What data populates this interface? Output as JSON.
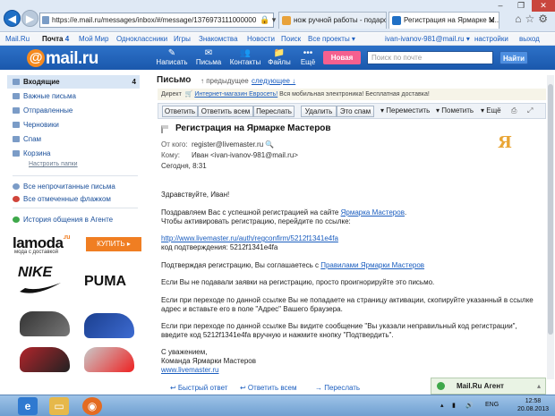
{
  "browser": {
    "url": "https://e.mail.ru/messages/inbox/#/message/1376973111000000",
    "tabs": [
      {
        "title": "нож ручной работы - подаро...",
        "active": false
      },
      {
        "title": "Регистрация на Ярмарке М...",
        "active": true
      }
    ]
  },
  "topnav": {
    "items": [
      "Mail.Ru",
      "Почта",
      "Мой Мир",
      "Одноклассники",
      "Игры",
      "Знакомства",
      "Новости",
      "Поиск",
      "Все проекты ▾"
    ],
    "mail_count": "4",
    "user": "ivan-ivanov-981@mail.ru ▾",
    "settings": "настройки",
    "logout": "выход"
  },
  "header": {
    "logo_text": "mail.ru",
    "buttons": [
      {
        "label": "Написать",
        "icon": "✎"
      },
      {
        "label": "Письма",
        "icon": "✉"
      },
      {
        "label": "Контакты",
        "icon": "👥"
      },
      {
        "label": "Файлы",
        "icon": "📁"
      },
      {
        "label": "Ещё",
        "icon": "•••"
      }
    ],
    "new_label": "Новая",
    "search_placeholder": "Поиск по почте",
    "find_label": "Найти"
  },
  "sidebar": {
    "folders": [
      {
        "label": "Входящие",
        "count": "4"
      },
      {
        "label": "Важные письма",
        "count": ""
      },
      {
        "label": "Отправленные",
        "count": ""
      },
      {
        "label": "Черновики",
        "count": ""
      },
      {
        "label": "Спам",
        "count": ""
      },
      {
        "label": "Корзина",
        "count": ""
      }
    ],
    "setup_folders": "Настроить папки",
    "unread_link": "Все непрочитанные письма",
    "flagged_link": "Все отмеченные флажком",
    "agent_history": "История общения в Агенте"
  },
  "ad": {
    "brand": "lamoda",
    "brand_suffix": ".ru",
    "subtitle": "мода с доставкой",
    "buy_label": "КУПИТЬ ▸",
    "logos": [
      "NIKE",
      "PUMA"
    ]
  },
  "message": {
    "heading": "Письмо",
    "prev": "↑ предыдущее",
    "next": "следующее ↓",
    "direct_label": "Директ",
    "direct_link": "Интернет-магазин Евросеть!",
    "direct_text": "Вся мобильная электроника! Бесплатная доставка!",
    "actions": [
      "Ответить",
      "Ответить всем",
      "Переслать",
      "Удалить",
      "Это спам"
    ],
    "dropdowns": [
      "▾ Переместить",
      "▾ Пометить",
      "▾ Ещё"
    ],
    "subject": "Регистрация на Ярмарке Мастеров",
    "from_label": "От кого:",
    "from_value": "register@livemaster.ru",
    "to_label": "Кому:",
    "to_value": "Иван <ivan-ivanov-981@mail.ru>",
    "date": "Сегодня, 8:31",
    "logo_mark": "Я",
    "greeting": "Здравствуйте, Иван!",
    "p1_line1_pre": "Поздравляем Вас с успешной регистрацией на сайте ",
    "p1_link": "Ярмарка Мастеров",
    "p1_line2": "Чтобы активировать регистрацию, перейдите по ссылке:",
    "confirm_link": "http://www.livemaster.ru/auth/regconfirm/5212f1341e4fa",
    "code_line": "код подтверждения: 5212f1341e4fa",
    "p2_pre": "Подтверждая регистрацию, Вы соглашаетесь с ",
    "p2_link": "Правилами Ярмарки Мастеров",
    "p3": "Если Вы не подавали заявки на регистрацию, просто проигнорируйте это письмо.",
    "p4_line1": "Если при переходе по данной ссылке Вы не попадаете на страницу активации, скопируйте указанный в ссылке",
    "p4_line2": "адрес и вставьте его в поле \"Адрес\" Вашего браузера.",
    "p5_line1": "Если при переходе по данной ссылке Вы видите сообщение \"Вы указали неправильный код регистрации\",",
    "p5_line2": "введите код 5212f1341e4fa вручную и нажмите кнопку \"Подтвердить\".",
    "sign1": "С уважением,",
    "sign2": "Команда Ярмарки Мастеров",
    "sign_link": "www.livemaster.ru",
    "quick_reply": "↩ Быстрый ответ",
    "reply_all": "↩ Ответить всем",
    "forward": "→ Переслать"
  },
  "agent": {
    "label": "Mail.Ru Агент"
  },
  "taskbar": {
    "lang": "ENG",
    "time": "12:58",
    "date": "20.08.2013"
  }
}
